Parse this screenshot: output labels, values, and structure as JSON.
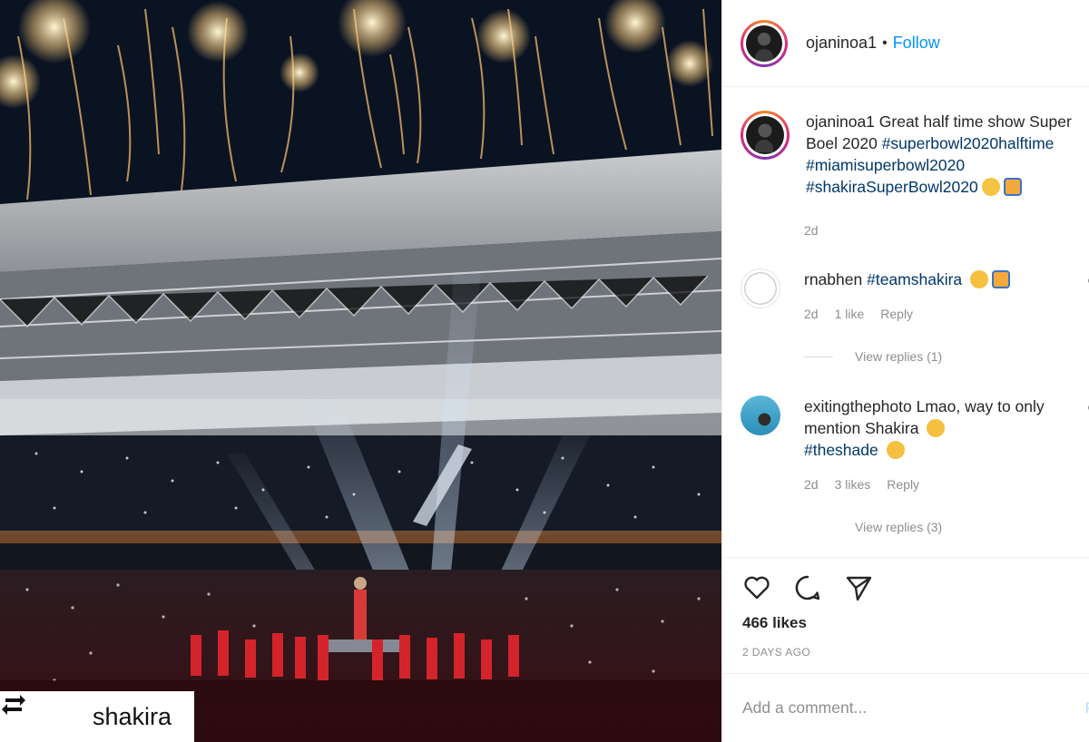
{
  "photo": {
    "repost_label": "shakira",
    "repost_icon": "repost-icon"
  },
  "header": {
    "username": "ojaninoa1",
    "separator": "•",
    "follow_label": "Follow"
  },
  "caption": {
    "username": "ojaninoa1",
    "text": "Great half time show Super Boel 2020",
    "hashtags": [
      "#superbowl2020halftime",
      "#miamisuperbowl2020",
      "#shakiraSuperBowl2020"
    ],
    "time": "2d"
  },
  "comments": [
    {
      "username": "rnabhen",
      "text": "#teamshakira",
      "time": "2d",
      "likes": "1 like",
      "reply_label": "Reply",
      "view_replies": "View replies (1)"
    },
    {
      "username": "exitingthephoto",
      "text": "Lmao, way to only mention Shakira",
      "hashtag": "#theshade",
      "time": "2d",
      "likes": "3 likes",
      "reply_label": "Reply",
      "view_replies": "View replies (3)"
    }
  ],
  "actions": {
    "like_icon": "heart-icon",
    "comment_icon": "comment-icon",
    "share_icon": "share-icon"
  },
  "likes_count": "466 likes",
  "post_date": "2 DAYS AGO",
  "add_comment": {
    "placeholder": "Add a comment...",
    "post_label": "P"
  },
  "colors": {
    "link": "#0095f6",
    "hashtag": "#00376b",
    "muted": "#8e8e8e"
  }
}
